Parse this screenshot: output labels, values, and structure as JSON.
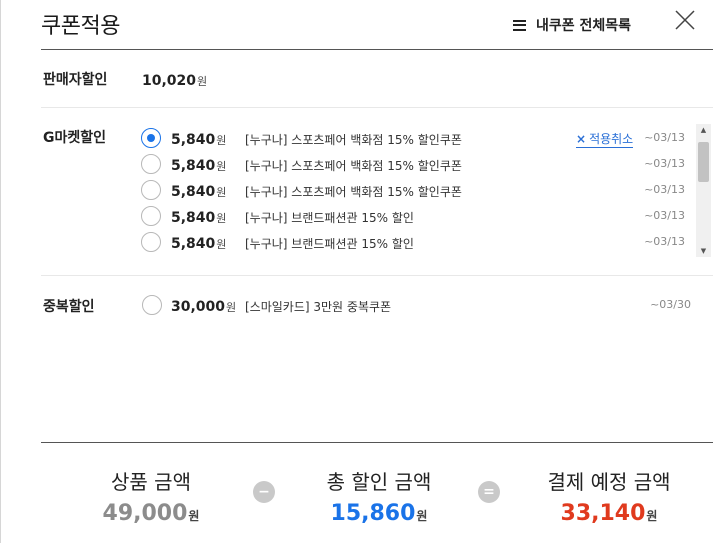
{
  "header": {
    "title": "쿠폰적용",
    "my_coupons_label": "내쿠폰 전체목록"
  },
  "currency_unit": "원",
  "seller": {
    "label": "판매자할인",
    "amount": "10,020"
  },
  "gmarket": {
    "label": "G마켓할인",
    "cancel_label": "적용취소",
    "coupons": [
      {
        "amount": "5,840",
        "name": "[누구나] 스포츠페어 백화점 15% 할인쿠폰",
        "date": "~03/13",
        "selected": true
      },
      {
        "amount": "5,840",
        "name": "[누구나] 스포츠페어 백화점 15% 할인쿠폰",
        "date": "~03/13",
        "selected": false
      },
      {
        "amount": "5,840",
        "name": "[누구나] 스포츠페어 백화점 15% 할인쿠폰",
        "date": "~03/13",
        "selected": false
      },
      {
        "amount": "5,840",
        "name": "[누구나] 브랜드패션관 15% 할인",
        "date": "~03/13",
        "selected": false
      },
      {
        "amount": "5,840",
        "name": "[누구나] 브랜드패션관 15% 할인",
        "date": "~03/13",
        "selected": false
      }
    ]
  },
  "duplicate": {
    "label": "중복할인",
    "coupon": {
      "amount": "30,000",
      "name": "[스마일카드] 3만원 중복쿠폰",
      "date": "~03/30",
      "selected": false
    }
  },
  "summary": {
    "product": {
      "label": "상품 금액",
      "value": "49,000"
    },
    "discount": {
      "label": "총 할인 금액",
      "value": "15,860"
    },
    "payment": {
      "label": "결제 예정 금액",
      "value": "33,140"
    },
    "minus": "−",
    "equals": "="
  },
  "colors": {
    "selected": "#1a73e8",
    "cancel_link": "#2a6fd6",
    "product_value": "#8c8c8c",
    "discount_value": "#1a73e8",
    "payment_value": "#e03a1e"
  }
}
